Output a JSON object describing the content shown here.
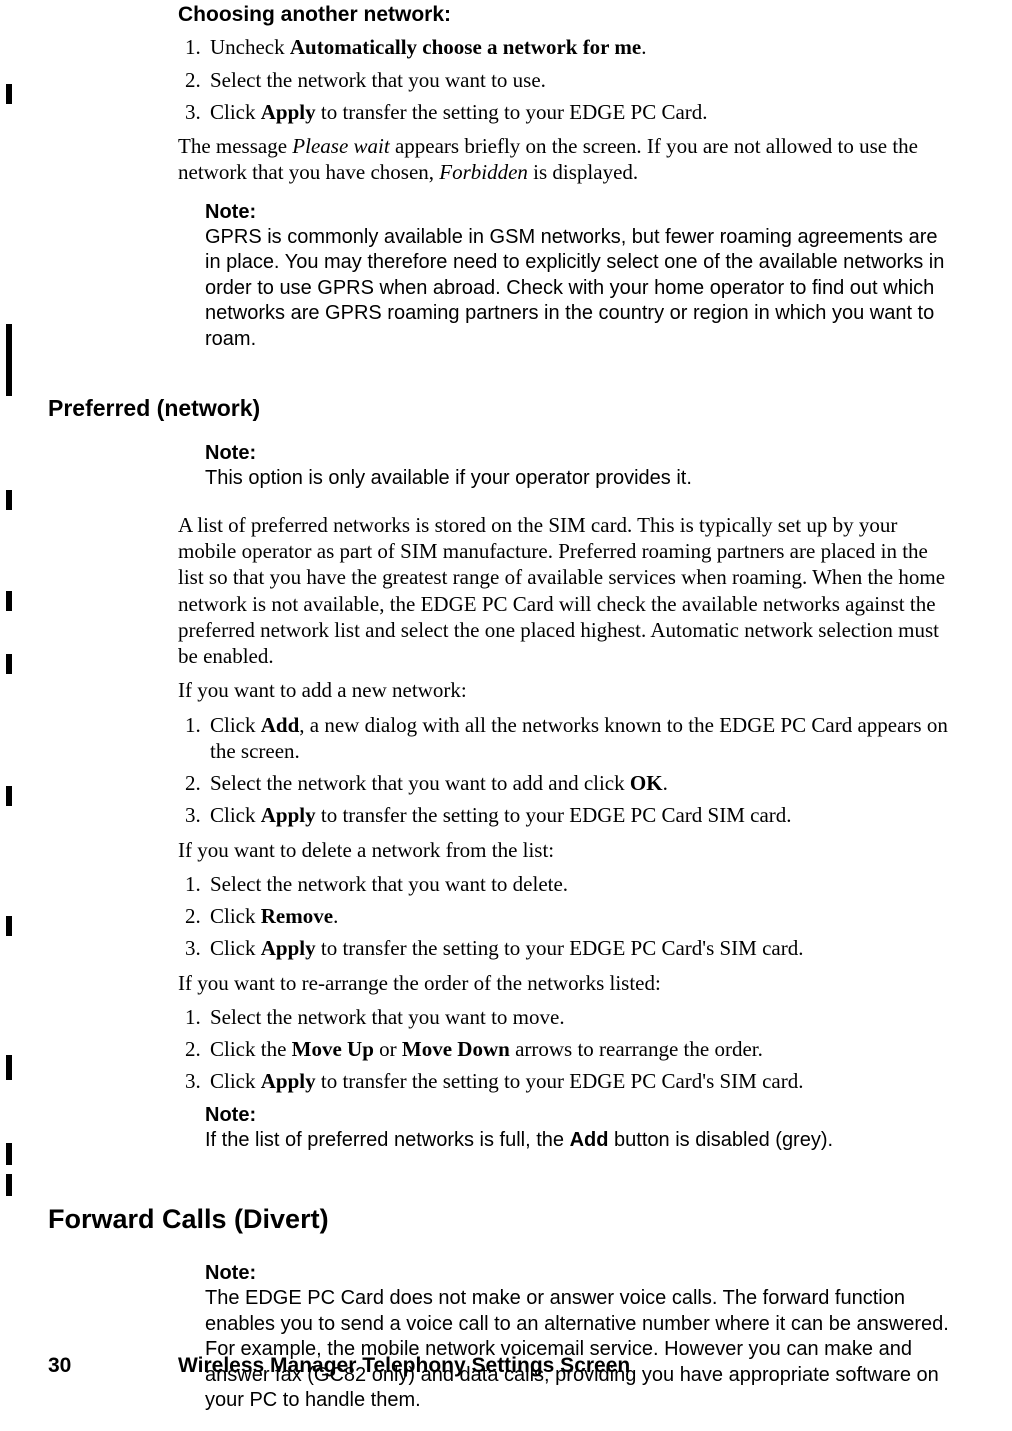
{
  "section1": {
    "title": "Choosing another network:",
    "step1_a": "Uncheck ",
    "step1_b": "Automatically choose a network for me",
    "step1_c": ".",
    "step2": "Select the network that you want to use.",
    "step3_a": "Click ",
    "step3_b": "Apply",
    "step3_c": " to transfer the setting to your EDGE PC Card.",
    "para_a": "The message ",
    "para_b": "Please wait",
    "para_c": " appears briefly on the screen. If you are not allowed to use the network that you have chosen, ",
    "para_d": "Forbidden",
    "para_e": " is displayed.",
    "note_label": "Note:",
    "note_body": "GPRS is commonly available in GSM networks, but fewer roaming agreements are in place. You may therefore need to explicitly select one of the available networks in order to use GPRS when abroad. Check with your home operator to find out which networks are GPRS roaming partners in the country or region in which you want to roam."
  },
  "section2": {
    "title": "Preferred (network)",
    "note1_label": "Note:",
    "note1_body": "This option is only available if your operator provides it.",
    "para1": "A list of preferred networks is stored on the SIM card. This is typically set up by your mobile operator as part of SIM manufacture. Preferred roaming partners are placed in the list so that you have the greatest range of available services when roaming. When the home network is not available, the EDGE PC Card will check the available networks against the preferred network list and select the one placed highest. Automatic network selection must be enabled.",
    "para2": "If you want to add a new network:",
    "add1_a": "Click ",
    "add1_b": "Add",
    "add1_c": ", a new dialog with all the networks known to the EDGE PC Card appears on the screen.",
    "add2_a": "Select the network that you want to add and click ",
    "add2_b": "OK",
    "add2_c": ".",
    "add3_a": "Click ",
    "add3_b": "Apply",
    "add3_c": " to transfer the setting to your EDGE PC Card SIM card.",
    "para3": "If you want to delete a network from the list:",
    "del1": "Select the network that you want to delete.",
    "del2_a": "Click ",
    "del2_b": "Remove",
    "del2_c": ".",
    "del3_a": "Click ",
    "del3_b": "Apply",
    "del3_c": " to transfer the setting to your EDGE PC Card's SIM card.",
    "para4": "If you want to re-arrange the order of the networks listed:",
    "mov1": "Select the network that you want to move.",
    "mov2_a": "Click the ",
    "mov2_b": "Move Up",
    "mov2_c": " or ",
    "mov2_d": "Move Down",
    "mov2_e": " arrows to rearrange the order.",
    "mov3_a": "Click ",
    "mov3_b": "Apply",
    "mov3_c": " to transfer the setting to your EDGE PC Card's SIM card.",
    "note2_label": "Note:",
    "note2_body_a": "If the list of preferred networks is full, the ",
    "note2_body_b": "Add",
    "note2_body_c": " button is disabled (grey)."
  },
  "section3": {
    "title": "Forward Calls (Divert)",
    "note_label": "Note:",
    "note_body": "The EDGE PC Card does not make or answer voice calls. The forward function enables you to send a voice call to an alternative number where it can be answered. For example, the mobile network voicemail service. However you can make and answer fax (GC82 only) and data calls, providing you have appropriate software on your PC to handle them."
  },
  "footer": {
    "page": "30",
    "title": "Wireless Manager Telephony Settings Screen"
  }
}
